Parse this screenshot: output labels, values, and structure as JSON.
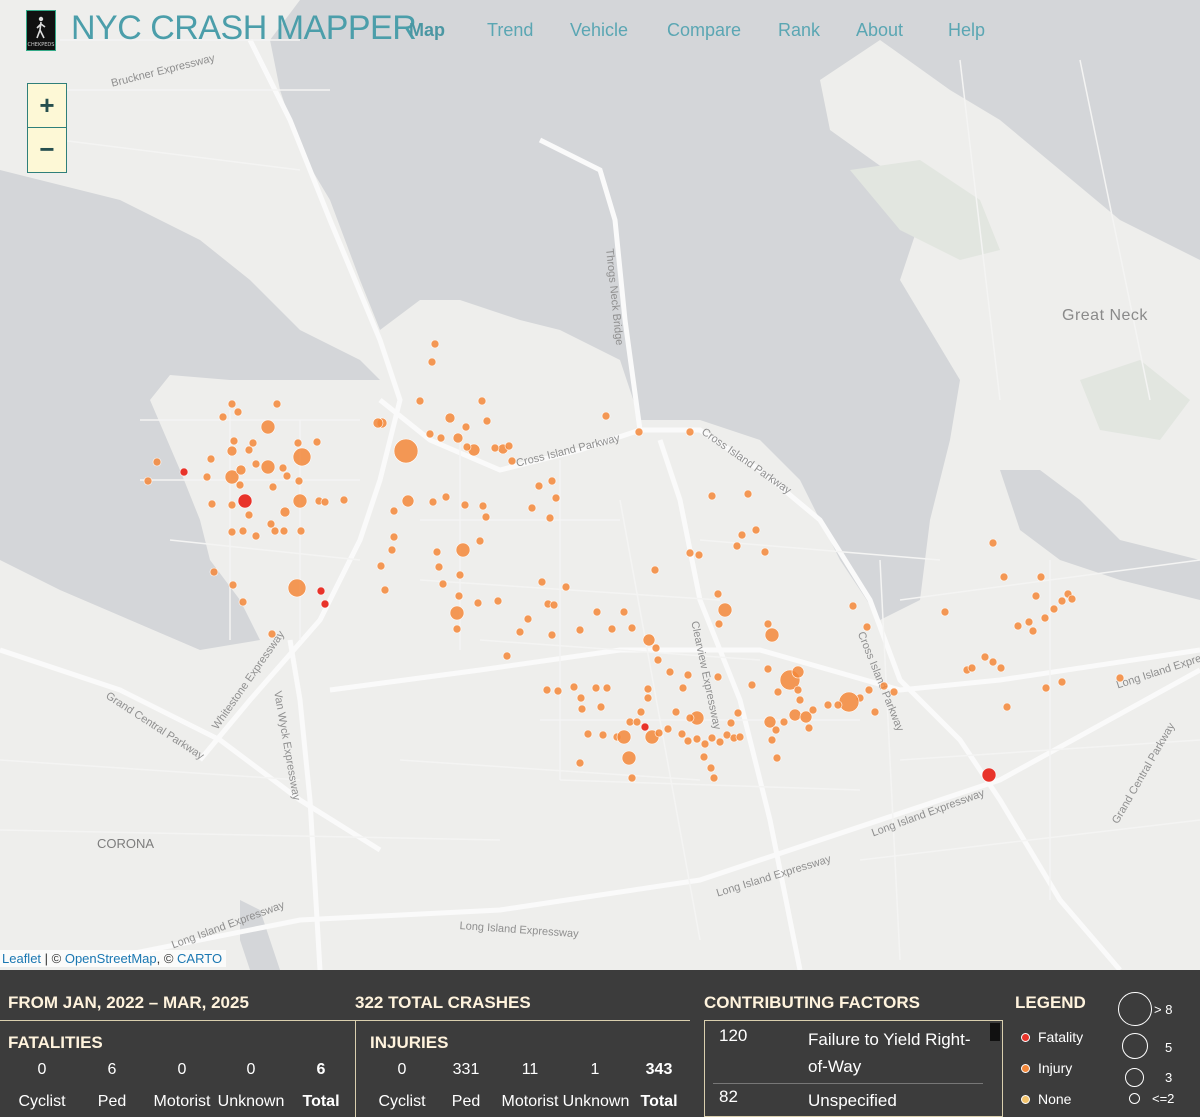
{
  "header": {
    "logo_text": "CHEKPEDS",
    "title": "NYC CRASH MAPPER",
    "nav": [
      "Map",
      "Trend",
      "Vehicle",
      "Compare",
      "Rank",
      "About",
      "Help"
    ],
    "active_nav": "Map"
  },
  "zoom": {
    "in": "+",
    "out": "−"
  },
  "attribution": {
    "leaflet": "Leaflet",
    "sep": " | © ",
    "osm": "OpenStreetMap",
    "comma": ", © ",
    "carto": "CARTO"
  },
  "map_labels": {
    "great_neck": "Great Neck",
    "corona": "CORONA",
    "bruckner": "Bruckner Expressway",
    "throgs": "Throgs Neck Bridge",
    "cross_island": "Cross Island Parkway",
    "cross_island2": "Cross Island Parkway",
    "whitestone": "Whitestone Expressway",
    "van_wyck": "Van Wyck Expressway",
    "grand_central": "Grand Central Parkway",
    "lie1": "Long Island Expressway",
    "lie2": "Long Island Expressway",
    "lie3": "Long Island Expressway",
    "lie4": "Long Island Expressway",
    "clearview": "Clearview Expressway",
    "grand_central2": "Grand Central Parkway",
    "lie_east": "Long Island Expressway",
    "cross_island_pkwy_s": "Cross Island Parkway"
  },
  "colors": {
    "fatality": "#e8332a",
    "injury": "#f3873a",
    "none": "#f3c36b",
    "panel": "#3c3c3c",
    "title": "#4b9eaa"
  },
  "panel": {
    "date_range": "FROM JAN, 2022 – MAR, 2025",
    "total_crashes": "322 TOTAL CRASHES",
    "fatalities": {
      "heading": "FATALITIES",
      "values": [
        "0",
        "6",
        "0",
        "0",
        "6"
      ],
      "labels": [
        "Cyclist",
        "Ped",
        "Motorist",
        "Unknown",
        "Total"
      ]
    },
    "injuries": {
      "heading": "INJURIES",
      "values": [
        "0",
        "331",
        "11",
        "1",
        "343"
      ],
      "labels": [
        "Cyclist",
        "Ped",
        "Motorist",
        "Unknown",
        "Total"
      ]
    },
    "factors": {
      "heading": "CONTRIBUTING FACTORS",
      "rows": [
        {
          "count": "120",
          "label": "Failure to Yield Right-of-Way"
        },
        {
          "count": "82",
          "label": "Unspecified"
        }
      ]
    },
    "legend": {
      "heading": "LEGEND",
      "types": [
        "Fatality",
        "Injury",
        "None"
      ],
      "sizes": [
        "> 8",
        "5",
        "3",
        "<=2"
      ]
    }
  }
}
